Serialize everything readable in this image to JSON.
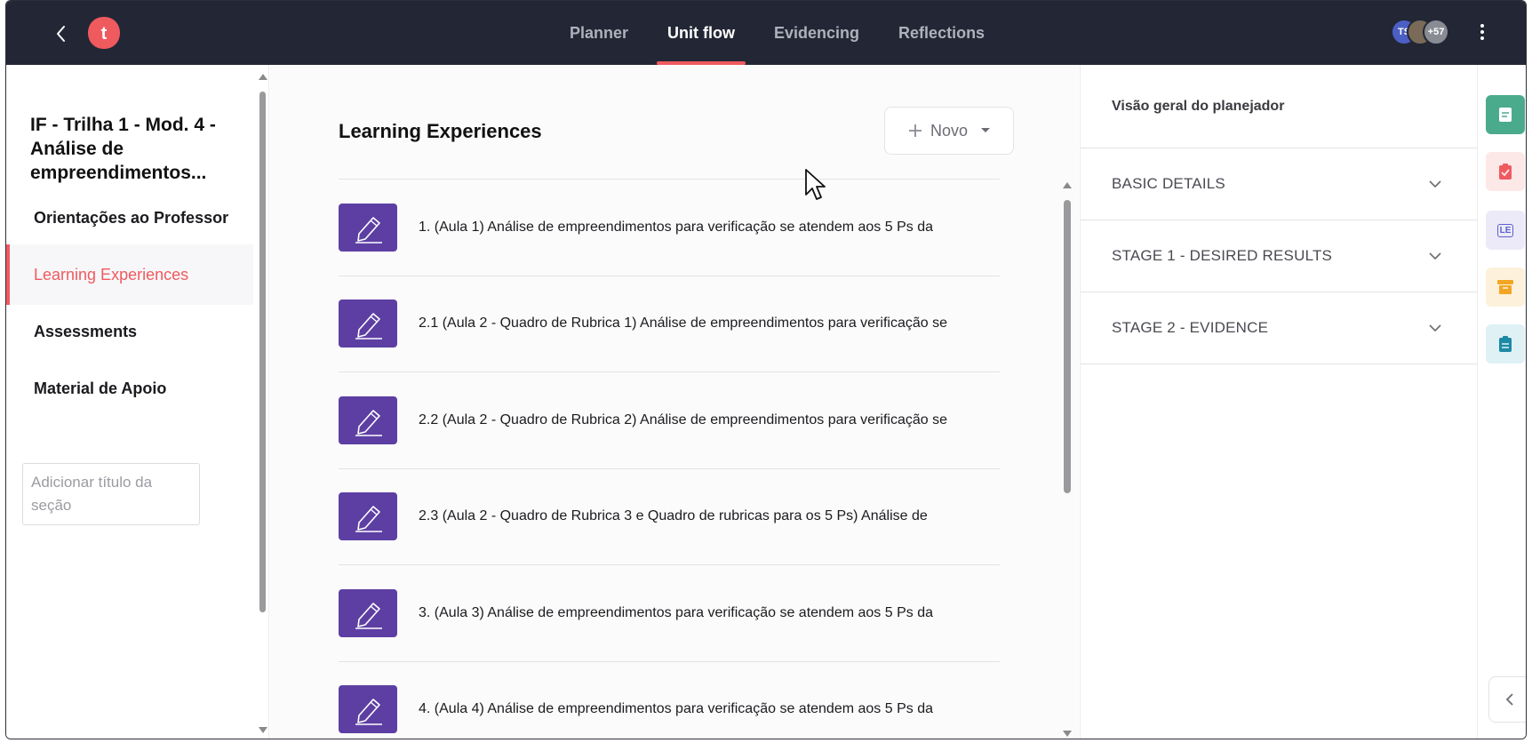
{
  "topbar": {
    "tabs": [
      {
        "label": "Planner",
        "active": false
      },
      {
        "label": "Unit flow",
        "active": true
      },
      {
        "label": "Evidencing",
        "active": false
      },
      {
        "label": "Reflections",
        "active": false
      }
    ],
    "logo_letter": "t",
    "avatars": [
      {
        "initials": "TS",
        "color": "#4b5fc4"
      },
      {
        "initials": "",
        "color": "#7a6a58"
      },
      {
        "initials": "+57",
        "color": "#8a8c94"
      }
    ],
    "accent_color": "#ef5a5f"
  },
  "sidebar": {
    "unit_title": "IF - Trilha 1 - Mod. 4 - Análise de empreendimentos...",
    "items": [
      {
        "label": "Orientações ao Professor",
        "active": false
      },
      {
        "label": "Learning Experiences",
        "active": true
      },
      {
        "label": "Assessments",
        "active": false
      },
      {
        "label": "Material de Apoio",
        "active": false
      }
    ],
    "section_input_placeholder": "Adicionar título da seção"
  },
  "main": {
    "heading": "Learning Experiences",
    "new_button_label": "Novo",
    "items": [
      {
        "title": "1. (Aula 1) Análise de empreendimentos para verificação se atendem aos 5 Ps da"
      },
      {
        "title": "2.1 (Aula 2 - Quadro de Rubrica 1) Análise de empreendimentos para verificação se"
      },
      {
        "title": "2.2 (Aula 2 - Quadro de Rubrica 2) Análise de empreendimentos para verificação se"
      },
      {
        "title": "2.3 (Aula 2 - Quadro de Rubrica 3 e Quadro de rubricas para os 5 Ps) Análise de"
      },
      {
        "title": "3. (Aula 3) Análise de empreendimentos para verificação se atendem aos 5 Ps da"
      },
      {
        "title": "4. (Aula 4) Análise de empreendimentos para verificação se atendem aos 5 Ps da"
      }
    ],
    "thumbnail_color": "#5d3fa3"
  },
  "right_panel": {
    "header": "Visão geral do planejador",
    "sections": [
      {
        "label": "BASIC DETAILS"
      },
      {
        "label": "STAGE 1 - DESIRED RESULTS"
      },
      {
        "label": "STAGE 2 - EVIDENCE"
      }
    ]
  },
  "rail": {
    "buttons": [
      {
        "icon": "document-icon",
        "bg": "#4aab8c",
        "fg": "#ffffff"
      },
      {
        "icon": "clipboard-check-icon",
        "bg": "#fde8e8",
        "fg": "#ef5a5f"
      },
      {
        "icon": "le-icon",
        "text": "LE",
        "bg": "#eceaf8",
        "fg": "#5d5fd0"
      },
      {
        "icon": "archive-icon",
        "bg": "#fdf1dc",
        "fg": "#f3a623"
      },
      {
        "icon": "clipboard-icon",
        "bg": "#dff1f5",
        "fg": "#1d8aa5"
      }
    ]
  }
}
